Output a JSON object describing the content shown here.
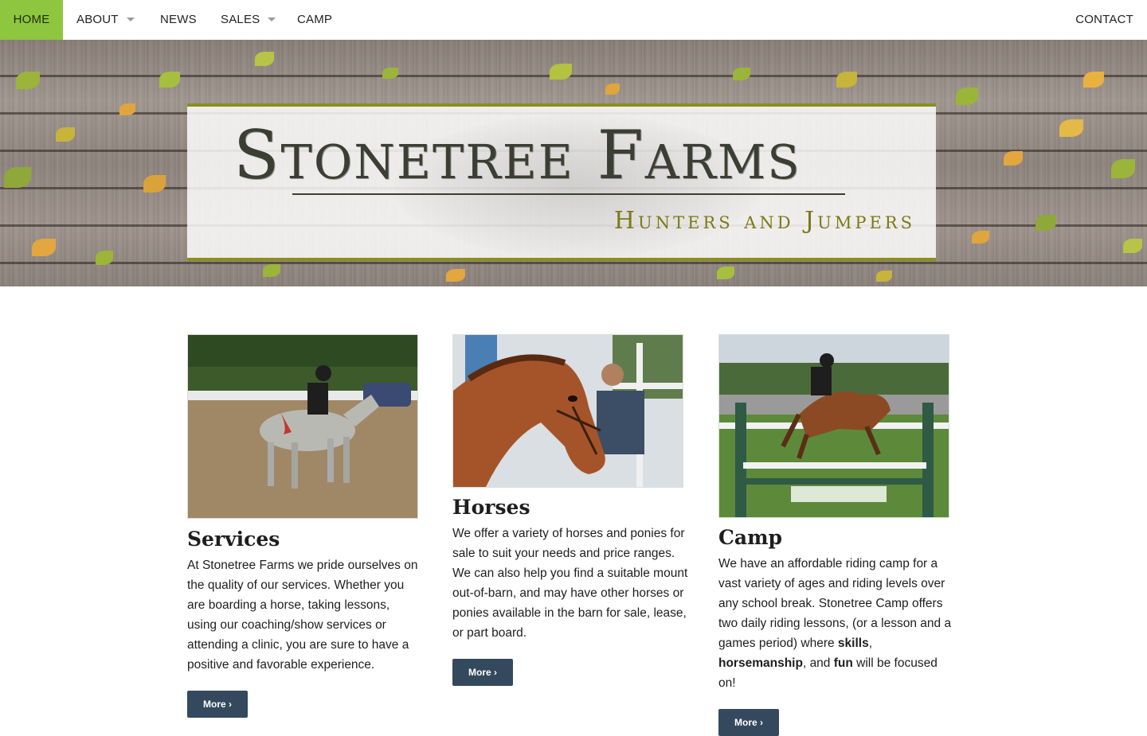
{
  "nav": {
    "items": [
      {
        "label": "HOME",
        "active": true,
        "dropdown": false
      },
      {
        "label": "ABOUT",
        "active": false,
        "dropdown": true
      },
      {
        "label": "NEWS",
        "active": false,
        "dropdown": false
      },
      {
        "label": "SALES",
        "active": false,
        "dropdown": true
      },
      {
        "label": "CAMP",
        "active": false,
        "dropdown": false
      }
    ],
    "contact_label": "CONTACT",
    "active_color": "#8ec63f"
  },
  "hero": {
    "title": "Stonetree Farms",
    "subtitle": "Hunters and Jumpers",
    "accent_color": "#8c8e1e"
  },
  "cards": [
    {
      "title": "Services",
      "text": "At Stonetree Farms we pride ourselves on the quality of our services. Whether you are boarding a horse, taking lessons, using our coaching/show services or attending a clinic, you are sure to have a positive and favorable experience.",
      "button": "More ›",
      "image_alt": "rider-on-grey-horse-photo"
    },
    {
      "title": "Horses",
      "text": "We offer a variety of horses and ponies for sale to suit your needs and price ranges. We can also help you find a suitable mount out-of-barn, and may have other horses or ponies available in the barn for sale, lease, or part board.",
      "button": "More ›",
      "image_alt": "chestnut-horse-braided-mane-photo"
    },
    {
      "title": "Camp",
      "text_parts": [
        "We have an affordable riding camp for a vast variety of ages and riding levels over any school break. Stonetree Camp offers two daily riding lessons, (or a lesson and a games period) where ",
        "skills",
        ", ",
        "horsemanship",
        ", and ",
        "fun",
        " will be focused on!"
      ],
      "button": "More ›",
      "image_alt": "pony-jumping-fence-photo"
    }
  ],
  "colors": {
    "button_bg": "#34495e",
    "text": "#1e1e1e"
  }
}
